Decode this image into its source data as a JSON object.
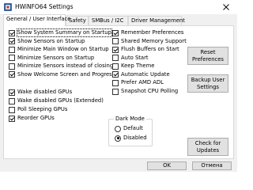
{
  "window": {
    "title": "HWiNFO64 Settings"
  },
  "tabs": [
    {
      "label": "General / User Interface"
    },
    {
      "label": "Safety"
    },
    {
      "label": "SMBus / I2C"
    },
    {
      "label": "Driver Management"
    }
  ],
  "left_options": [
    {
      "label": "Show System Summary on Startup",
      "checked": true
    },
    {
      "label": "Show Sensors on Startup",
      "checked": true
    },
    {
      "label": "Minimize Main Window on Startup",
      "checked": false
    },
    {
      "label": "Minimize Sensors on Startup",
      "checked": false
    },
    {
      "label": "Minimize Sensors instead of closing",
      "checked": false
    },
    {
      "label": "Show Welcome Screen and Progress",
      "checked": true
    },
    {
      "label": "Wake disabled GPUs",
      "checked": true
    },
    {
      "label": "Wake disabled GPUs (Extended)",
      "checked": false
    },
    {
      "label": "Poll Sleeping GPUs",
      "checked": false
    },
    {
      "label": "Reorder GPUs",
      "checked": true
    }
  ],
  "right_options": [
    {
      "label": "Remember Preferences",
      "checked": true
    },
    {
      "label": "Shared Memory Support",
      "checked": false
    },
    {
      "label": "Flush Buffers on Start",
      "checked": true
    },
    {
      "label": "Auto Start",
      "checked": false
    },
    {
      "label": "Keep Theme",
      "checked": false
    },
    {
      "label": "Automatic Update",
      "checked": true
    },
    {
      "label": "Prefer AMD ADL",
      "checked": false
    },
    {
      "label": "Snapshot CPU Polling",
      "checked": false
    }
  ],
  "dark_mode": {
    "label": "Dark Mode",
    "options": [
      "Default",
      "Disabled"
    ],
    "selected": "Disabled"
  },
  "buttons": {
    "reset": "Reset Preferences",
    "backup": "Backup User Settings",
    "check_updates": "Check for Updates",
    "ok": "OK",
    "cancel": "Отмена"
  }
}
